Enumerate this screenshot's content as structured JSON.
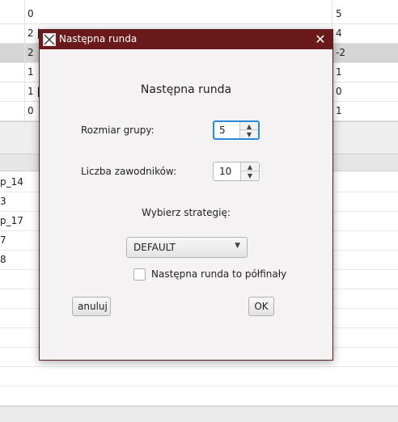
{
  "background": {
    "top_rows": [
      {
        "c1": "0",
        "c2": "5",
        "selected": false
      },
      {
        "c1": "2 |",
        "c2": "4",
        "selected": false
      },
      {
        "c1": "2",
        "c2": "-2",
        "selected": true
      },
      {
        "c1": "1",
        "c2": "1",
        "selected": false
      },
      {
        "c1": "1 |",
        "c2": "0",
        "selected": false
      },
      {
        "c1": "0",
        "c2": "1",
        "selected": false
      }
    ],
    "bottom_rows": [
      "p_14",
      "3",
      "p_17",
      "7",
      "8"
    ]
  },
  "dialog": {
    "title": "Następna runda",
    "heading": "Następna runda",
    "group_size": {
      "label": "Rozmiar grupy:",
      "value": "5"
    },
    "players": {
      "label": "Liczba zawodników:",
      "value": "10"
    },
    "strategy": {
      "label": "Wybierz strategię:",
      "value": "DEFAULT"
    },
    "semifinal": {
      "label": "Następna runda to półfinały",
      "checked": false
    },
    "cancel_label": "anuluj",
    "ok_label": "OK"
  },
  "colors": {
    "titlebar": "#6a1a1a",
    "focus": "#2a8ad8",
    "selected_row": "#d5d5d5"
  }
}
